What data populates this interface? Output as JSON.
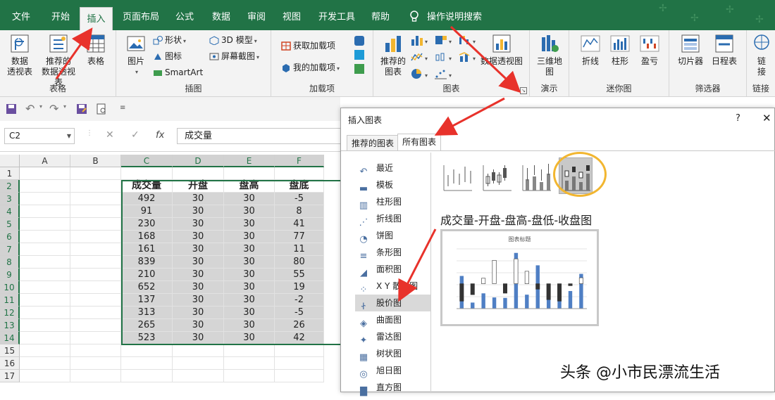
{
  "menubar": {
    "tabs": [
      "文件",
      "开始",
      "插入",
      "页面布局",
      "公式",
      "数据",
      "审阅",
      "视图",
      "开发工具",
      "帮助"
    ],
    "search": "操作说明搜索",
    "active": "插入"
  },
  "ribbon": {
    "table": {
      "label": "表格",
      "pivot": "数据\n透视表",
      "recommended_pivot": "推荐的\n数据透视表",
      "table_btn": "表格"
    },
    "illus": {
      "label": "插图",
      "picture": "图片",
      "shapes": "形状",
      "icons": "图标",
      "smartart": "SmartArt",
      "model3d": "3D 模型",
      "screenshot": "屏幕截图"
    },
    "addins": {
      "label": "加载项",
      "get": "获取加载项",
      "mine": "我的加载项"
    },
    "charts": {
      "label": "图表",
      "recommended": "推荐的\n图表",
      "pivotchart": "数据透视图"
    },
    "tours": {
      "label": "演示",
      "map3d": "三维地\n图"
    },
    "spark": {
      "label": "迷你图",
      "line": "折线",
      "column": "柱形",
      "winloss": "盈亏"
    },
    "filters": {
      "label": "筛选器",
      "slicer": "切片器",
      "timeline": "日程表"
    },
    "links": {
      "label": "链接",
      "link": "链\n接"
    }
  },
  "namebox": "C2",
  "formula": "成交量",
  "columns": [
    "A",
    "B",
    "C",
    "D",
    "E",
    "F"
  ],
  "rows": [
    "1",
    "2",
    "3",
    "4",
    "5",
    "6",
    "7",
    "8",
    "9",
    "10",
    "11",
    "12",
    "13",
    "14",
    "15",
    "16",
    "17"
  ],
  "table": {
    "headers": [
      "成交量",
      "开盘",
      "盘高",
      "盘底"
    ],
    "data": [
      [
        "492",
        "30",
        "30",
        "-5"
      ],
      [
        "91",
        "30",
        "30",
        "8"
      ],
      [
        "230",
        "30",
        "30",
        "41"
      ],
      [
        "168",
        "30",
        "30",
        "77"
      ],
      [
        "161",
        "30",
        "30",
        "11"
      ],
      [
        "839",
        "30",
        "30",
        "80"
      ],
      [
        "210",
        "30",
        "30",
        "55"
      ],
      [
        "652",
        "30",
        "30",
        "19"
      ],
      [
        "137",
        "30",
        "30",
        "-2"
      ],
      [
        "313",
        "30",
        "30",
        "-5"
      ],
      [
        "265",
        "30",
        "30",
        "26"
      ],
      [
        "523",
        "30",
        "30",
        "42"
      ]
    ]
  },
  "dialog": {
    "title": "插入图表",
    "help": "?",
    "close": "✕",
    "tabs": [
      "推荐的图表",
      "所有图表"
    ],
    "types": [
      "最近",
      "模板",
      "柱形图",
      "折线图",
      "饼图",
      "条形图",
      "面积图",
      "X Y 散点图",
      "股价图",
      "曲面图",
      "雷达图",
      "树状图",
      "旭日图",
      "直方图"
    ],
    "subtype_title": "成交量-开盘-盘高-盘低-收盘图",
    "preview_title": "图表标题"
  },
  "watermark": "头条 @小市民漂流生活",
  "colors": {
    "excel_green": "#217346",
    "arrow_red": "#e8322b",
    "highlight": "#f2b630"
  }
}
